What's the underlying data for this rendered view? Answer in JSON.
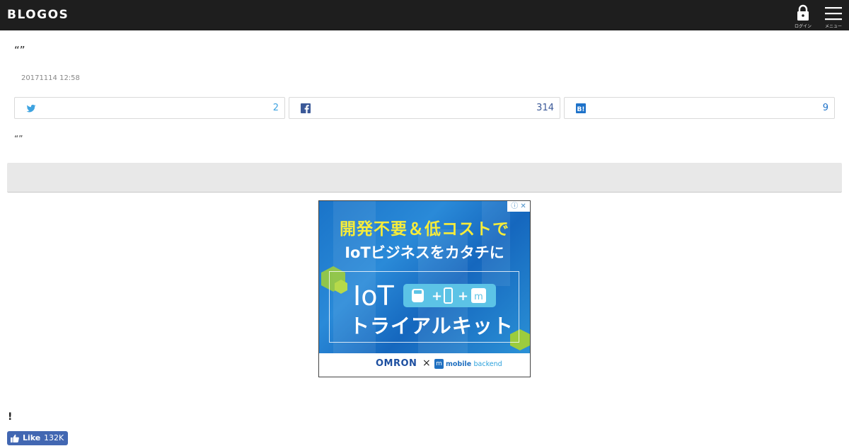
{
  "header": {
    "logo": "BLOGOS",
    "login_label": "ログイン",
    "menu_label": "メニュー",
    "colors": {
      "background": "#1e1e1e",
      "text": "#ffffff"
    }
  },
  "article": {
    "title": "“”",
    "date": "20171114 12:58",
    "lead": "“”"
  },
  "share": {
    "twitter": {
      "icon": "twitter-icon",
      "count": "2",
      "color": "#3ea3e0"
    },
    "facebook": {
      "icon": "facebook-icon",
      "count": "314",
      "color": "#3b5998"
    },
    "hatena": {
      "icon": "hatena-bookmark-icon",
      "icon_text": "B!",
      "count": "9",
      "color": "#1e72c9"
    }
  },
  "ad": {
    "info_icon": "ⓘ",
    "close_icon": "✕",
    "line1": "開発不要＆低コストで",
    "line2": "IoTビジネスをカタチに",
    "product": "IoT",
    "kit": "トライアルキット",
    "brand1": "OMRON",
    "cross": "×",
    "brand2_icon_text": "m",
    "brand2_a": "mobile",
    "brand2_b": "backend"
  },
  "footer": {
    "exclaim": "!",
    "like_label": "Like",
    "like_count": "132K"
  }
}
